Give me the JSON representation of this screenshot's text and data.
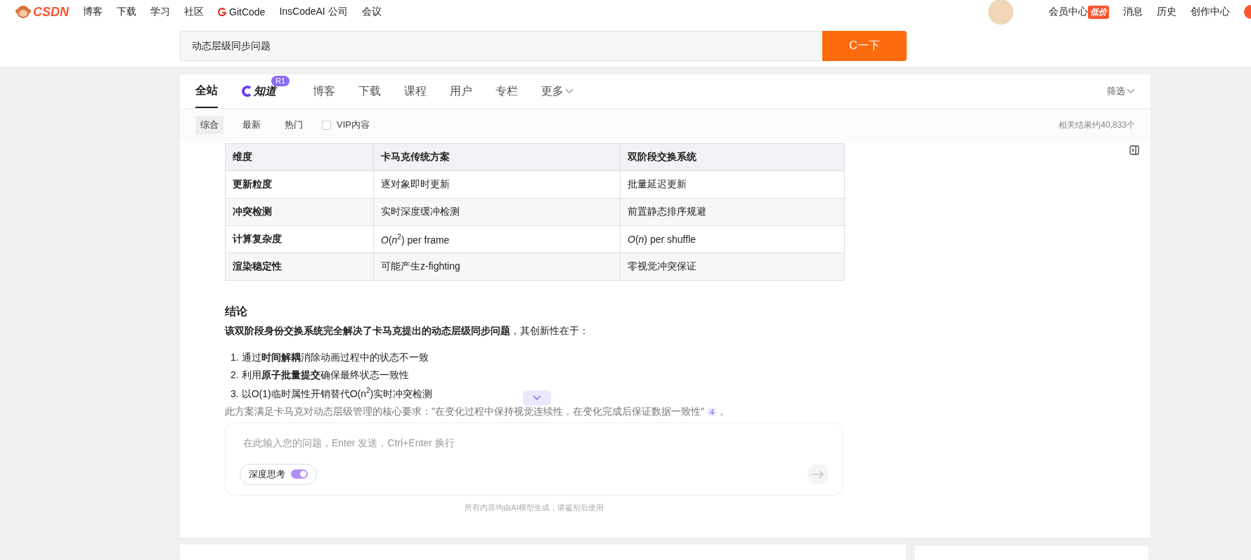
{
  "top_nav": {
    "logo": "CSDN",
    "links": [
      {
        "label": "博客",
        "kind": "text"
      },
      {
        "label": "下载",
        "kind": "text"
      },
      {
        "label": "学习",
        "kind": "text"
      },
      {
        "label": "社区",
        "kind": "text"
      },
      {
        "label": "GitCode",
        "kind": "gitcode"
      },
      {
        "label": "InsCodeAI 公司",
        "kind": "text"
      },
      {
        "label": "会议",
        "kind": "text"
      }
    ],
    "right_links": [
      {
        "label": "会员中心",
        "badge": "低价"
      },
      {
        "label": "消息"
      },
      {
        "label": "历史"
      },
      {
        "label": "创作中心"
      }
    ]
  },
  "search": {
    "value": "动态层级同步问题",
    "button": "C一下"
  },
  "tabs": [
    {
      "label": "全站",
      "selected": true,
      "kind": "text"
    },
    {
      "label": "知道",
      "badge": "R1",
      "selected": false,
      "kind": "logo"
    },
    {
      "label": "博客",
      "selected": false,
      "kind": "text"
    },
    {
      "label": "下载",
      "selected": false,
      "kind": "text"
    },
    {
      "label": "课程",
      "selected": false,
      "kind": "text"
    },
    {
      "label": "用户",
      "selected": false,
      "kind": "text"
    },
    {
      "label": "专栏",
      "selected": false,
      "kind": "text"
    },
    {
      "label": "更多",
      "selected": false,
      "kind": "menu"
    }
  ],
  "filter_menu": "筛选",
  "sort_options": [
    {
      "label": "综合",
      "selected": true
    },
    {
      "label": "最新",
      "selected": false
    },
    {
      "label": "热门",
      "selected": false
    }
  ],
  "vip_filter": {
    "label": "VIP内容",
    "checked": false
  },
  "result_count": "相关结果约40,833个",
  "table": {
    "columns": [
      "维度",
      "卡马克传统方案",
      "双阶段交换系统"
    ],
    "rows": [
      [
        "更新粒度",
        "逐对象即时更新",
        "批量延迟更新"
      ],
      [
        "冲突检测",
        "实时深度缓冲检测",
        "前置静态排序规避"
      ],
      [
        "计算复杂度",
        "*O*(*n*$^{2}$) per frame",
        "*O*(*n*) per shuffle"
      ],
      [
        "渲染稳定性",
        "可能产生z-fighting",
        "零视觉冲突保证"
      ]
    ]
  },
  "conclusion": {
    "heading": "结论",
    "intro": "**该双阶段身份交换系统完全解决了卡马克提出的动态层级同步问题**，其创新性在于：",
    "items": [
      {
        "number": "1.",
        "text": "通过**时间解耦**消除动画过程中的状态不一致"
      },
      {
        "number": "2.",
        "text": "利用**原子批量提交**确保最终状态一致性"
      },
      {
        "number": "3.",
        "text": "以O(1)临时属性开销替代O(n$^{2}$)实时冲突检测"
      }
    ],
    "summary": "此方案满足卡马克对动态层级管理的核心要求：\"在变化过程中保持视觉连续性，在变化完成后保证数据一致性\"",
    "citation": "4",
    "end": "。"
  },
  "chat_input": {
    "placeholder": "在此输入您的问题，Enter 发送，Ctrl+Enter 换行",
    "deep_think": {
      "label": "深度思考",
      "on": true
    }
  },
  "disclaimer": "所有内容均由AI模型生成，请鉴别后使用"
}
